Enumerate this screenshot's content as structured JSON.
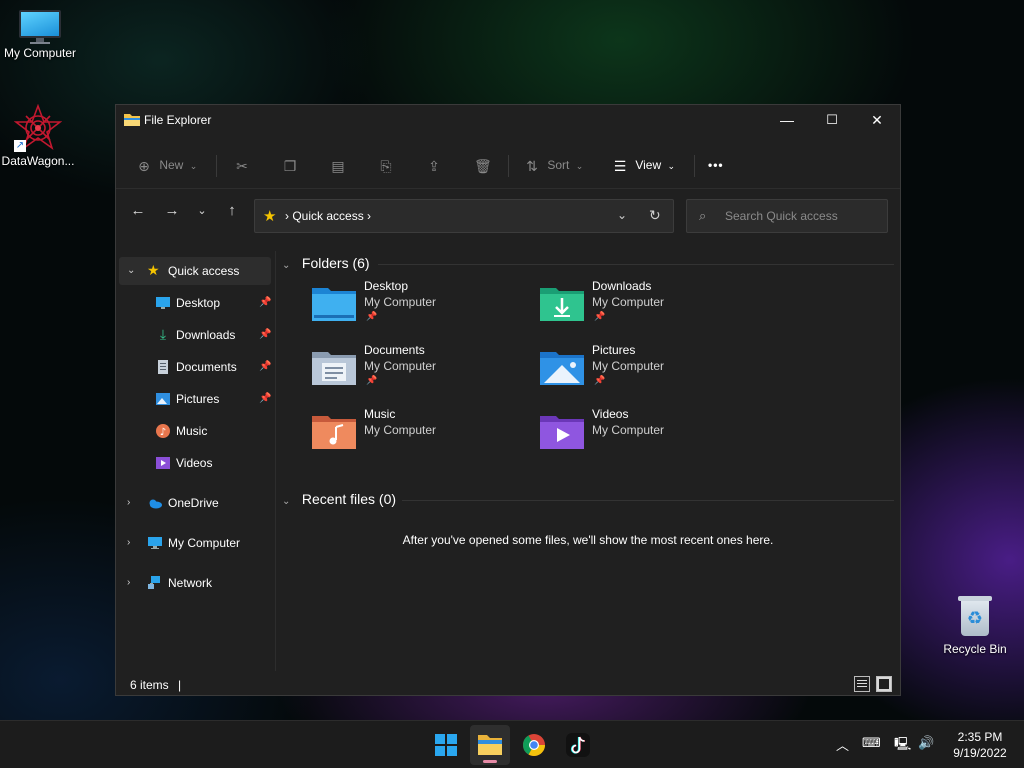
{
  "desktop": {
    "icons": [
      {
        "label": "My Computer",
        "icon": "monitor-icon"
      },
      {
        "label": "DataWagon...",
        "icon": "datawagon-logo-icon"
      }
    ],
    "recycle_bin": {
      "label": "Recycle Bin",
      "icon": "recycle-bin-icon"
    }
  },
  "window": {
    "title": "File Explorer",
    "controls": {
      "minimize": "—",
      "maximize": "☐",
      "close": "✕"
    }
  },
  "toolbar": {
    "new_label": "New",
    "sort_label": "Sort",
    "view_label": "View",
    "more_label": "•••"
  },
  "address": {
    "crumb": "Quick access",
    "search_placeholder": "Search Quick access"
  },
  "sidebar": {
    "quick_access": "Quick access",
    "items": [
      {
        "label": "Desktop",
        "icon": "desktop-icon",
        "pinned": true
      },
      {
        "label": "Downloads",
        "icon": "download-icon",
        "pinned": true
      },
      {
        "label": "Documents",
        "icon": "document-icon",
        "pinned": true
      },
      {
        "label": "Pictures",
        "icon": "pictures-icon",
        "pinned": true
      },
      {
        "label": "Music",
        "icon": "music-icon",
        "pinned": false
      },
      {
        "label": "Videos",
        "icon": "videos-icon",
        "pinned": false
      }
    ],
    "roots": [
      {
        "label": "OneDrive",
        "icon": "cloud-icon"
      },
      {
        "label": "My Computer",
        "icon": "computer-icon"
      },
      {
        "label": "Network",
        "icon": "network-icon"
      }
    ]
  },
  "content": {
    "folders_header": "Folders (6)",
    "folders": [
      {
        "name": "Desktop",
        "location": "My Computer",
        "pinned": true
      },
      {
        "name": "Downloads",
        "location": "My Computer",
        "pinned": true
      },
      {
        "name": "Documents",
        "location": "My Computer",
        "pinned": true
      },
      {
        "name": "Pictures",
        "location": "My Computer",
        "pinned": true
      },
      {
        "name": "Music",
        "location": "My Computer",
        "pinned": false
      },
      {
        "name": "Videos",
        "location": "My Computer",
        "pinned": false
      }
    ],
    "recent_header": "Recent files (0)",
    "recent_empty": "After you've opened some files, we'll show the most recent ones here."
  },
  "status": {
    "items_count": "6 items",
    "separator": "|"
  },
  "taskbar": {
    "apps": [
      "start-icon",
      "file-explorer-icon",
      "chrome-icon",
      "tiktok-icon"
    ],
    "time": "2:35 PM",
    "date": "9/19/2022"
  },
  "colors": {
    "window_bg": "#202020",
    "accent_star": "#f5c400",
    "selected_bg": "#2d2d2d"
  }
}
